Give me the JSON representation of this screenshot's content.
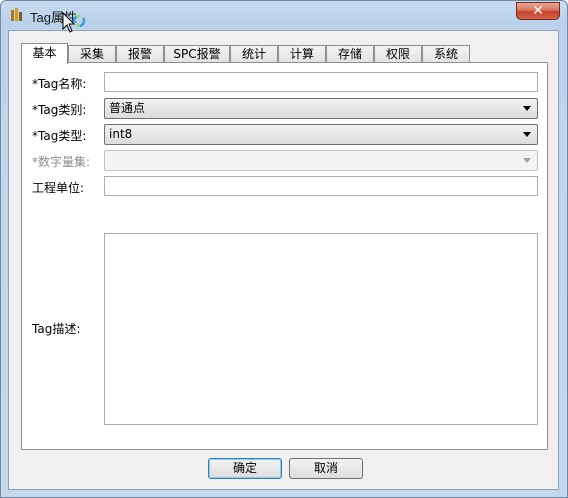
{
  "window": {
    "title": "Tag属性",
    "close_label": "✕"
  },
  "tabs": [
    {
      "label": "基本"
    },
    {
      "label": "采集"
    },
    {
      "label": "报警"
    },
    {
      "label": "SPC报警"
    },
    {
      "label": "统计"
    },
    {
      "label": "计算"
    },
    {
      "label": "存储"
    },
    {
      "label": "权限"
    },
    {
      "label": "系统"
    }
  ],
  "form": {
    "name_label": "*Tag名称:",
    "name_value": "",
    "category_label": "*Tag类别:",
    "category_value": "普通点",
    "type_label": "*Tag类型:",
    "type_value": "int8",
    "numeric_set_label": "*数字量集:",
    "numeric_set_value": "",
    "unit_label": "工程单位:",
    "unit_value": "",
    "description_label": "Tag描述:",
    "description_value": ""
  },
  "buttons": {
    "ok_label": "确定",
    "cancel_label": "取消"
  },
  "colors": {
    "title_bar": "#b9d1ea",
    "close_button": "#c4422a",
    "panel_bg": "#ffffff",
    "dialog_bg": "#f0f0f0"
  }
}
